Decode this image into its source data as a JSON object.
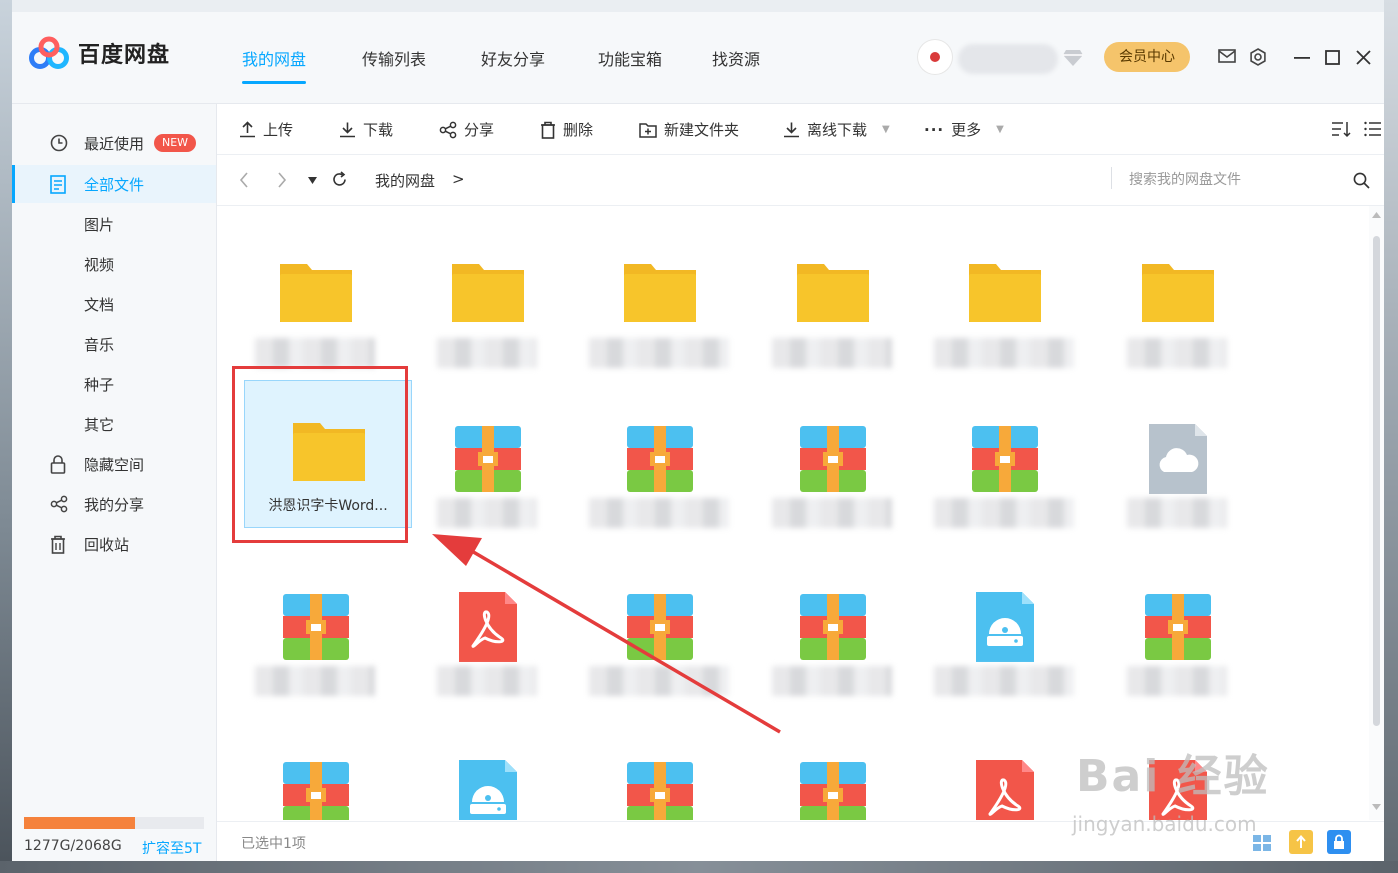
{
  "app": {
    "name": "百度网盘"
  },
  "nav": {
    "tabs": [
      "我的网盘",
      "传输列表",
      "好友分享",
      "功能宝箱",
      "找资源"
    ],
    "active": 0
  },
  "header": {
    "vip_label": "会员中心"
  },
  "sidebar": {
    "items": [
      {
        "label": "最近使用",
        "badge": "NEW"
      },
      {
        "label": "全部文件"
      },
      {
        "label": "图片"
      },
      {
        "label": "视频"
      },
      {
        "label": "文档"
      },
      {
        "label": "音乐"
      },
      {
        "label": "种子"
      },
      {
        "label": "其它"
      },
      {
        "label": "隐藏空间"
      },
      {
        "label": "我的分享"
      },
      {
        "label": "回收站"
      }
    ],
    "quota": {
      "text": "1277G/2068G",
      "used_fraction": 0.617,
      "expand_label": "扩容至5T"
    }
  },
  "toolbar": {
    "upload": "上传",
    "download": "下载",
    "share": "分享",
    "delete": "删除",
    "new_folder": "新建文件夹",
    "offline_download": "离线下载",
    "more": "更多"
  },
  "path": {
    "root": "我的网盘",
    "separator": ">"
  },
  "search": {
    "placeholder": "搜索我的网盘文件"
  },
  "files": {
    "selected_name": "洪恩识字卡Word...",
    "rows": [
      [
        "folder",
        "folder",
        "folder",
        "folder",
        "folder",
        "folder"
      ],
      [
        "folder",
        "archive",
        "archive",
        "archive",
        "archive",
        "cloud"
      ],
      [
        "archive",
        "pdf",
        "archive",
        "archive",
        "disc",
        "archive"
      ],
      [
        "archive",
        "disc",
        "archive",
        "archive",
        "pdf",
        "pdf"
      ]
    ]
  },
  "status": {
    "text": "已选中1项"
  },
  "watermark": {
    "brand": "Bai 经验",
    "url": "jingyan.baidu.com"
  },
  "colors": {
    "accent": "#06a7ff",
    "highlight": "#e43c3c",
    "folder": "#f7c52b"
  }
}
